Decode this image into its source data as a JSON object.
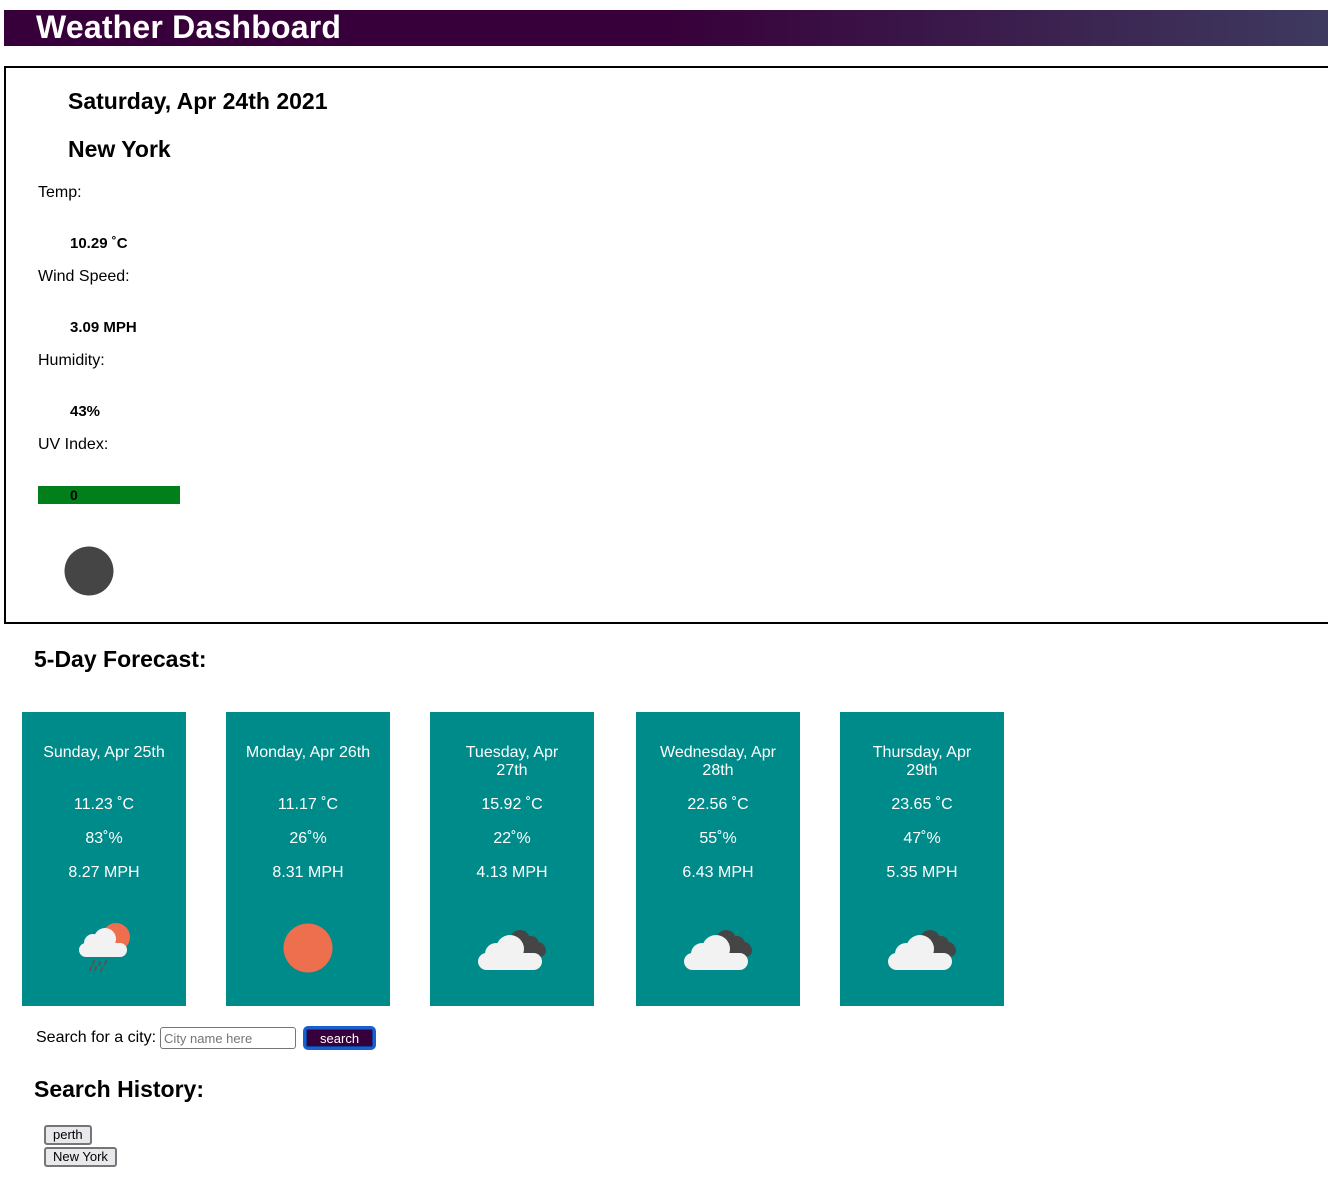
{
  "header": {
    "title": "Weather Dashboard"
  },
  "current": {
    "date": "Saturday, Apr 24th 2021",
    "city": "New York",
    "temp_label": "Temp:",
    "temp_value": "10.29 ˚C",
    "wind_label": "Wind Speed:",
    "wind_value": "3.09 MPH",
    "humidity_label": "Humidity:",
    "humidity_value": "43%",
    "uv_label": "UV Index:",
    "uv_value": "0",
    "uv_color": "#007f1a",
    "icon": "moon-icon"
  },
  "forecast": {
    "title": "5-Day Forecast:",
    "card_color": "#008b8b",
    "days": [
      {
        "day": "Sunday, Apr 25th",
        "temp": "11.23 ˚C",
        "humidity": "83˚%",
        "wind": "8.27 MPH",
        "icon": "rain-sun-icon"
      },
      {
        "day": "Monday, Apr 26th",
        "temp": "11.17 ˚C",
        "humidity": "26˚%",
        "wind": "8.31 MPH",
        "icon": "sun-icon"
      },
      {
        "day": "Tuesday, Apr 27th",
        "temp": "15.92 ˚C",
        "humidity": "22˚%",
        "wind": "4.13 MPH",
        "icon": "clouds-icon"
      },
      {
        "day": "Wednesday, Apr 28th",
        "temp": "22.56 ˚C",
        "humidity": "55˚%",
        "wind": "6.43 MPH",
        "icon": "clouds-icon"
      },
      {
        "day": "Thursday, Apr 29th",
        "temp": "23.65 ˚C",
        "humidity": "47˚%",
        "wind": "5.35 MPH",
        "icon": "clouds-icon"
      }
    ]
  },
  "search": {
    "label": "Search for a city:",
    "placeholder": "City name here",
    "button_label": "search"
  },
  "history": {
    "title": "Search History:",
    "items": [
      "perth",
      "New York"
    ]
  }
}
